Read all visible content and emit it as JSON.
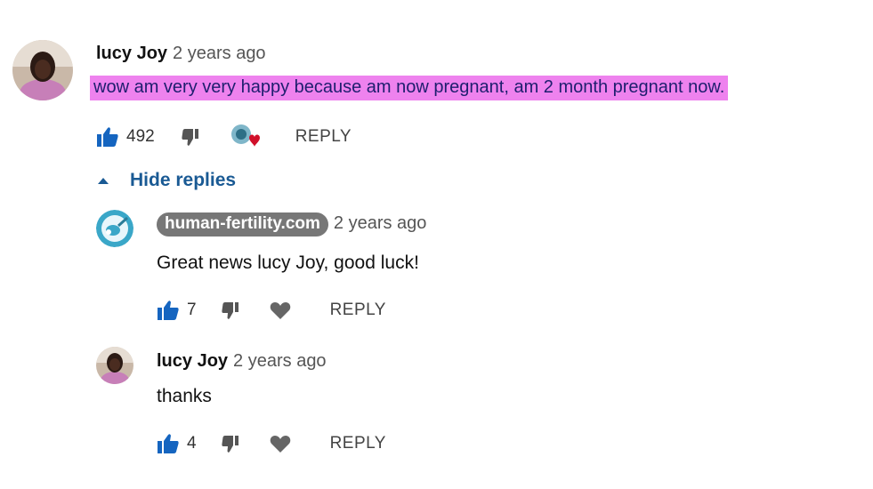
{
  "colors": {
    "highlight": "#ee82ee",
    "like_icon": "#1565c0",
    "link": "#1a5a94",
    "badge_bg": "#777777",
    "heart": "#d0102a"
  },
  "comment": {
    "author": "lucy Joy",
    "time": "2 years ago",
    "text": "wow am very very happy  because am now pregnant, am 2 month pregnant now.",
    "likes": "492",
    "reply_label": "REPLY",
    "icons": [
      "avatar-photo",
      "thumbs-up-icon",
      "thumbs-down-icon",
      "creator-heart-icon"
    ]
  },
  "hide_replies": {
    "label": "Hide replies",
    "icon": "caret-up-icon"
  },
  "replies": [
    {
      "author": "human-fertility.com",
      "author_is_channel": true,
      "time": "2 years ago",
      "text": "Great news lucy Joy, good luck!",
      "likes": "7",
      "reply_label": "REPLY",
      "icons": [
        "channel-logo-icon",
        "thumbs-up-icon",
        "thumbs-down-icon",
        "heart-icon"
      ]
    },
    {
      "author": "lucy Joy",
      "author_is_channel": false,
      "time": "2 years ago",
      "text": "thanks",
      "likes": "4",
      "reply_label": "REPLY",
      "icons": [
        "avatar-photo",
        "thumbs-up-icon",
        "thumbs-down-icon",
        "heart-icon"
      ]
    }
  ]
}
